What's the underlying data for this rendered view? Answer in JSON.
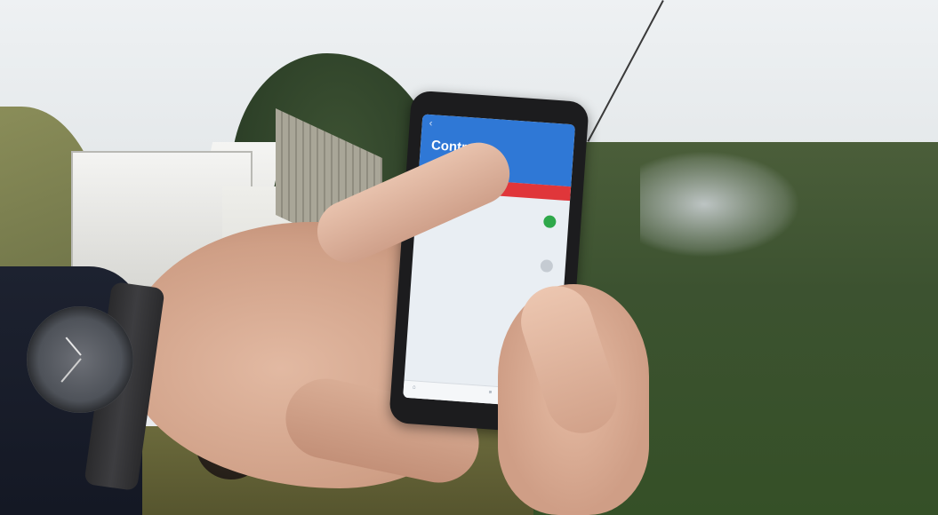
{
  "phone_app": {
    "title": "Controle",
    "tabs": [
      "",
      ""
    ],
    "rows": [
      {
        "label": "",
        "value": "",
        "state": "on"
      },
      {
        "label": "",
        "value": "",
        "state": "off"
      },
      {
        "label": "",
        "value": "",
        "state": "on"
      },
      {
        "label": "",
        "value": "",
        "state": "on"
      }
    ],
    "accent_color": "#2f78d6",
    "tab_bar_color": "#e0363a",
    "toggle_on_color": "#2ea84a"
  },
  "watch": {
    "brand": ""
  }
}
